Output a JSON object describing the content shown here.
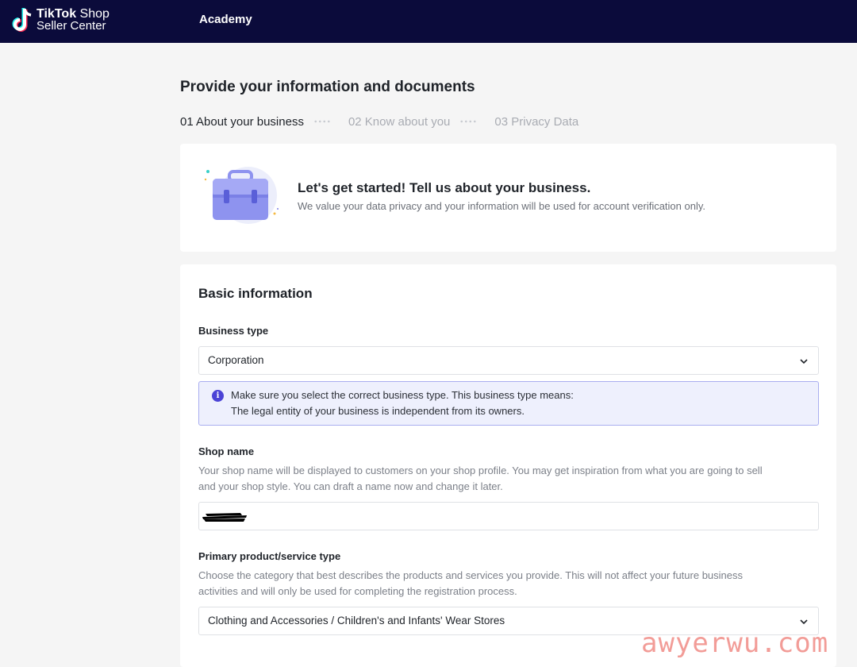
{
  "header": {
    "logo_word_bold": "TikTok",
    "logo_word_light": "Shop",
    "logo_line2": "Seller Center",
    "nav_academy": "Academy"
  },
  "page": {
    "title": "Provide your information and documents",
    "steps": [
      {
        "label": "01 About your business",
        "active": true
      },
      {
        "label": "02 Know about you",
        "active": false
      },
      {
        "label": "03 Privacy Data",
        "active": false
      }
    ]
  },
  "intro": {
    "icon": "briefcase-icon",
    "title": "Let's get started! Tell us about your business.",
    "subtitle": "We value your data privacy and your information will be used for account verification only."
  },
  "basic_info": {
    "section_title": "Basic information",
    "business_type": {
      "label": "Business type",
      "value": "Corporation",
      "notice_line1": "Make sure you select the correct business type. This business type means:",
      "notice_line2": "The legal entity of your business is independent from its owners."
    },
    "shop_name": {
      "label": "Shop name",
      "desc_line1": "Your shop name will be displayed to customers on your shop profile. You may get inspiration from what you are going to sell",
      "desc_line2": "and your shop style. You can draft a name now and change it later."
    },
    "primary_type": {
      "label": "Primary product/service type",
      "desc_line1": "Choose the category that best describes the products and services you provide. This will not affect your future business",
      "desc_line2": "activities and will only be used for completing the registration process.",
      "value": "Clothing and Accessories / Children's and Infants' Wear Stores"
    }
  },
  "watermark": "awyerwu.com",
  "colors": {
    "header_bg": "#0b0b3b",
    "accent": "#4b43d6",
    "notice_bg": "#eef0fd",
    "page_bg": "#f5f5f5"
  }
}
